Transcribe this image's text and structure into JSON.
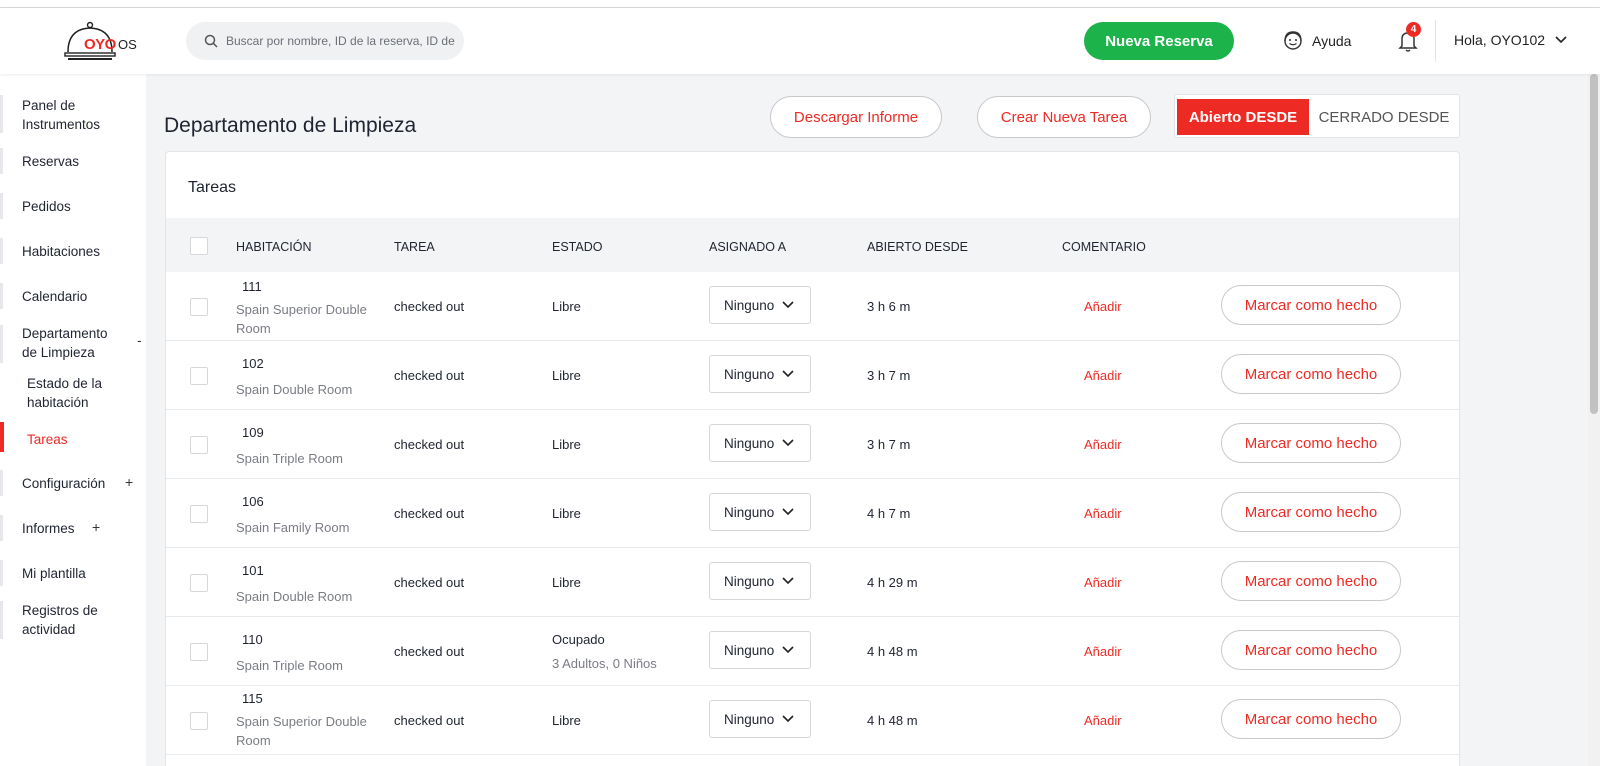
{
  "header": {
    "logo_text": "OYO",
    "logo_suffix": "OS",
    "search_placeholder": "Buscar por nombre, ID de la reserva, ID de",
    "new_booking": "Nueva Reserva",
    "help": "Ayuda",
    "notifications_count": "4",
    "user_greeting": "Hola, OYO102"
  },
  "sidebar": {
    "items": [
      {
        "label": "Panel de Instrumentos"
      },
      {
        "label": "Reservas"
      },
      {
        "label": "Pedidos"
      },
      {
        "label": "Habitaciones"
      },
      {
        "label": "Calendario"
      },
      {
        "label": "Departamento de Limpieza",
        "toggle": "-"
      },
      {
        "label": "Estado de la habitación"
      },
      {
        "label": "Tareas"
      },
      {
        "label": "Configuración",
        "toggle": "+"
      },
      {
        "label": "Informes",
        "toggle": "+"
      },
      {
        "label": "Mi plantilla"
      },
      {
        "label": "Registros de actividad"
      }
    ]
  },
  "main": {
    "title": "Departamento de Limpieza",
    "download_report": "Descargar Informe",
    "create_task": "Crear Nueva Tarea",
    "toggle_open": "Abierto DESDE",
    "toggle_closed": "CERRADO DESDE"
  },
  "tasks": {
    "title": "Tareas",
    "columns": [
      "HABITACIÓN",
      "TAREA",
      "ESTADO",
      "ASIGNADO A",
      "ABIERTO DESDE",
      "COMENTARIO"
    ],
    "rows": [
      {
        "room": "111",
        "type": "Spain Superior Double Room",
        "task": "checked out",
        "status": "Libre",
        "status_detail": "",
        "assigned": "Ninguno",
        "open_since": "3 h 6 m",
        "comment": "Añadir",
        "action": "Marcar como hecho"
      },
      {
        "room": "102",
        "type": "Spain Double Room",
        "task": "checked out",
        "status": "Libre",
        "status_detail": "",
        "assigned": "Ninguno",
        "open_since": "3 h 7 m",
        "comment": "Añadir",
        "action": "Marcar como hecho"
      },
      {
        "room": "109",
        "type": "Spain Triple Room",
        "task": "checked out",
        "status": "Libre",
        "status_detail": "",
        "assigned": "Ninguno",
        "open_since": "3 h 7 m",
        "comment": "Añadir",
        "action": "Marcar como hecho"
      },
      {
        "room": "106",
        "type": "Spain Family Room",
        "task": "checked out",
        "status": "Libre",
        "status_detail": "",
        "assigned": "Ninguno",
        "open_since": "4 h 7 m",
        "comment": "Añadir",
        "action": "Marcar como hecho"
      },
      {
        "room": "101",
        "type": "Spain Double Room",
        "task": "checked out",
        "status": "Libre",
        "status_detail": "",
        "assigned": "Ninguno",
        "open_since": "4 h 29 m",
        "comment": "Añadir",
        "action": "Marcar como hecho"
      },
      {
        "room": "110",
        "type": "Spain Triple Room",
        "task": "checked out",
        "status": "Ocupado",
        "status_detail": "3 Adultos, 0 Niños",
        "assigned": "Ninguno",
        "open_since": "4 h 48 m",
        "comment": "Añadir",
        "action": "Marcar como hecho"
      },
      {
        "room": "115",
        "type": "Spain Superior Double Room",
        "task": "checked out",
        "status": "Libre",
        "status_detail": "",
        "assigned": "Ninguno",
        "open_since": "4 h 48 m",
        "comment": "Añadir",
        "action": "Marcar como hecho"
      }
    ]
  },
  "colors": {
    "brand_red": "#ee2a24",
    "brand_green": "#1cb34a"
  }
}
